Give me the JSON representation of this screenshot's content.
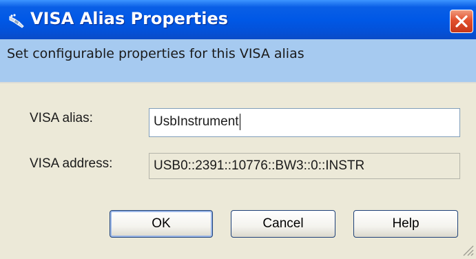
{
  "window": {
    "title": "VISA Alias Properties",
    "icon": "visa-plug-icon",
    "close_icon": "close-icon"
  },
  "header": {
    "text": "Set configurable properties for this VISA alias"
  },
  "form": {
    "alias_label": "VISA alias:",
    "alias_value": "UsbInstrument",
    "address_label": "VISA address:",
    "address_value": "USB0::2391::10776::BW3::0::INSTR"
  },
  "buttons": {
    "ok": "OK",
    "cancel": "Cancel",
    "help": "Help"
  },
  "colors": {
    "titlebar": "#0058e6",
    "header_band": "#a6caf0",
    "dialog_bg": "#ece9d8",
    "close_button": "#e2512e"
  }
}
